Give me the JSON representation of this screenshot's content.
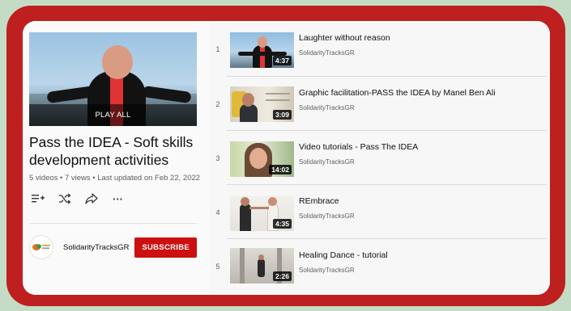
{
  "playlist": {
    "hero_label": "PLAY ALL",
    "title": "Pass the IDEA - Soft skills development activities",
    "meta": "5 videos • 7 views • Last updated on Feb 22, 2022",
    "actions": {
      "save_icon": "add-to-queue-icon",
      "shuffle_icon": "shuffle-icon",
      "share_icon": "share-icon",
      "more_label": "···"
    }
  },
  "channel": {
    "name": "SolidarityTracksGR",
    "subscribe_label": "SUBSCRIBE"
  },
  "videos": [
    {
      "index": "1",
      "title": "Laughter without reason",
      "channel": "SolidarityTracksGR",
      "duration": "4:37"
    },
    {
      "index": "2",
      "title": "Graphic facilitation-PASS the IDEA by Manel Ben Ali",
      "channel": "SolidarityTracksGR",
      "duration": "3:09"
    },
    {
      "index": "3",
      "title": "Video tutorials - Pass The IDEA",
      "channel": "SolidarityTracksGR",
      "duration": "14:02"
    },
    {
      "index": "4",
      "title": "REmbrace",
      "channel": "SolidarityTracksGR",
      "duration": "4:35"
    },
    {
      "index": "5",
      "title": "Healing Dance - tutorial",
      "channel": "SolidarityTracksGR",
      "duration": "2:26"
    }
  ],
  "colors": {
    "frame": "#be1f1f",
    "background": "#c4dcc6",
    "subscribe": "#cc1010"
  }
}
